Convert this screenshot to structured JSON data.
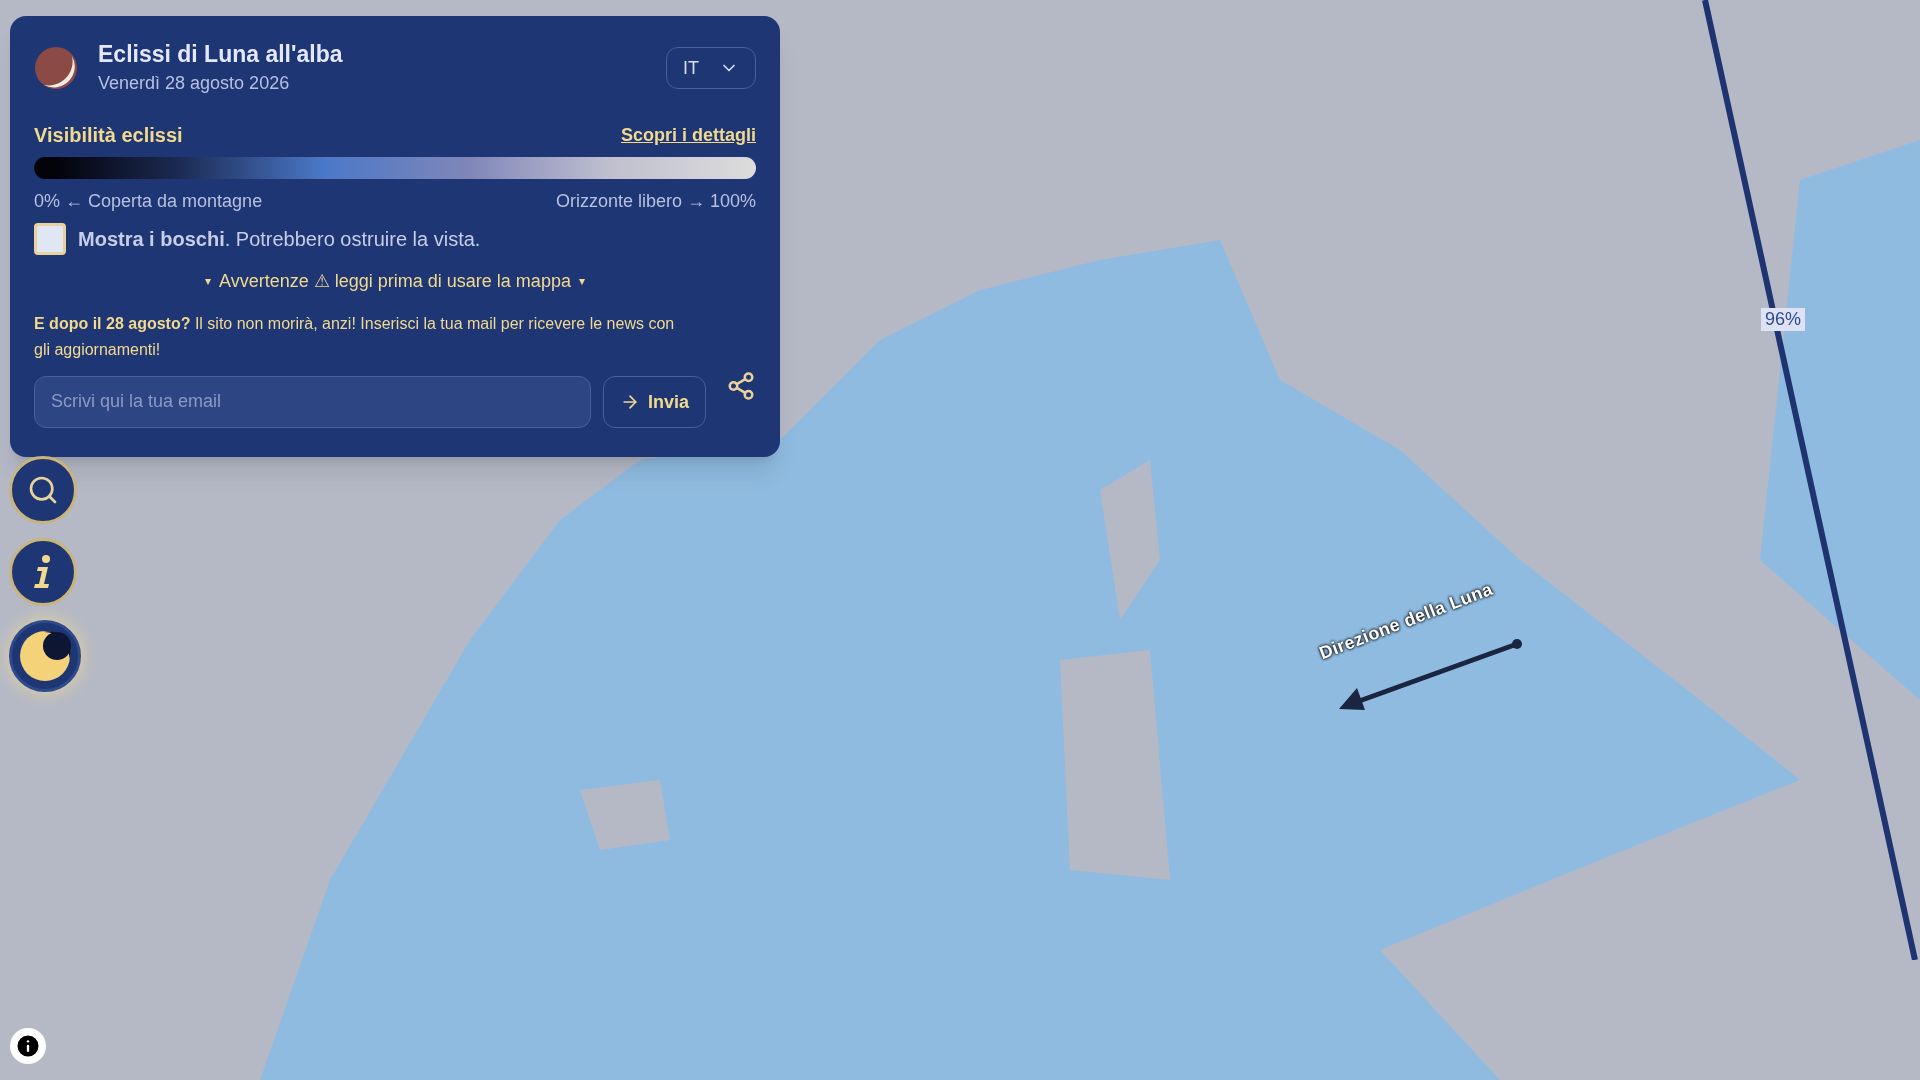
{
  "panel": {
    "title": "Eclissi di Luna all'alba",
    "date": "Venerdì 28 agosto 2026",
    "language": "IT",
    "visibility": {
      "label": "Visibilità eclissi",
      "link": "Scopri i dettagli",
      "left_label": "0% ← Coperta da montagne",
      "right_label": "Orizzonte libero → 100%"
    },
    "forest_toggle": {
      "checked": false,
      "label": "**Mostra i boschi**. Potrebbero ostruire la vista."
    },
    "warning": {
      "marker": "▾",
      "text": "Avvertenze ⚠ leggi prima di usare la mappa"
    },
    "newsletter": {
      "text": "**E dopo il 28 agosto?** Il sito non morirà, anzi! Inserisci la tua mail per ricevere le news con gli aggiornamenti!",
      "placeholder": "Scrivi qui la tua email",
      "button": "Invia"
    }
  },
  "map_overlays": {
    "direction_label": "Direzione della Luna",
    "line_label": "96%"
  }
}
